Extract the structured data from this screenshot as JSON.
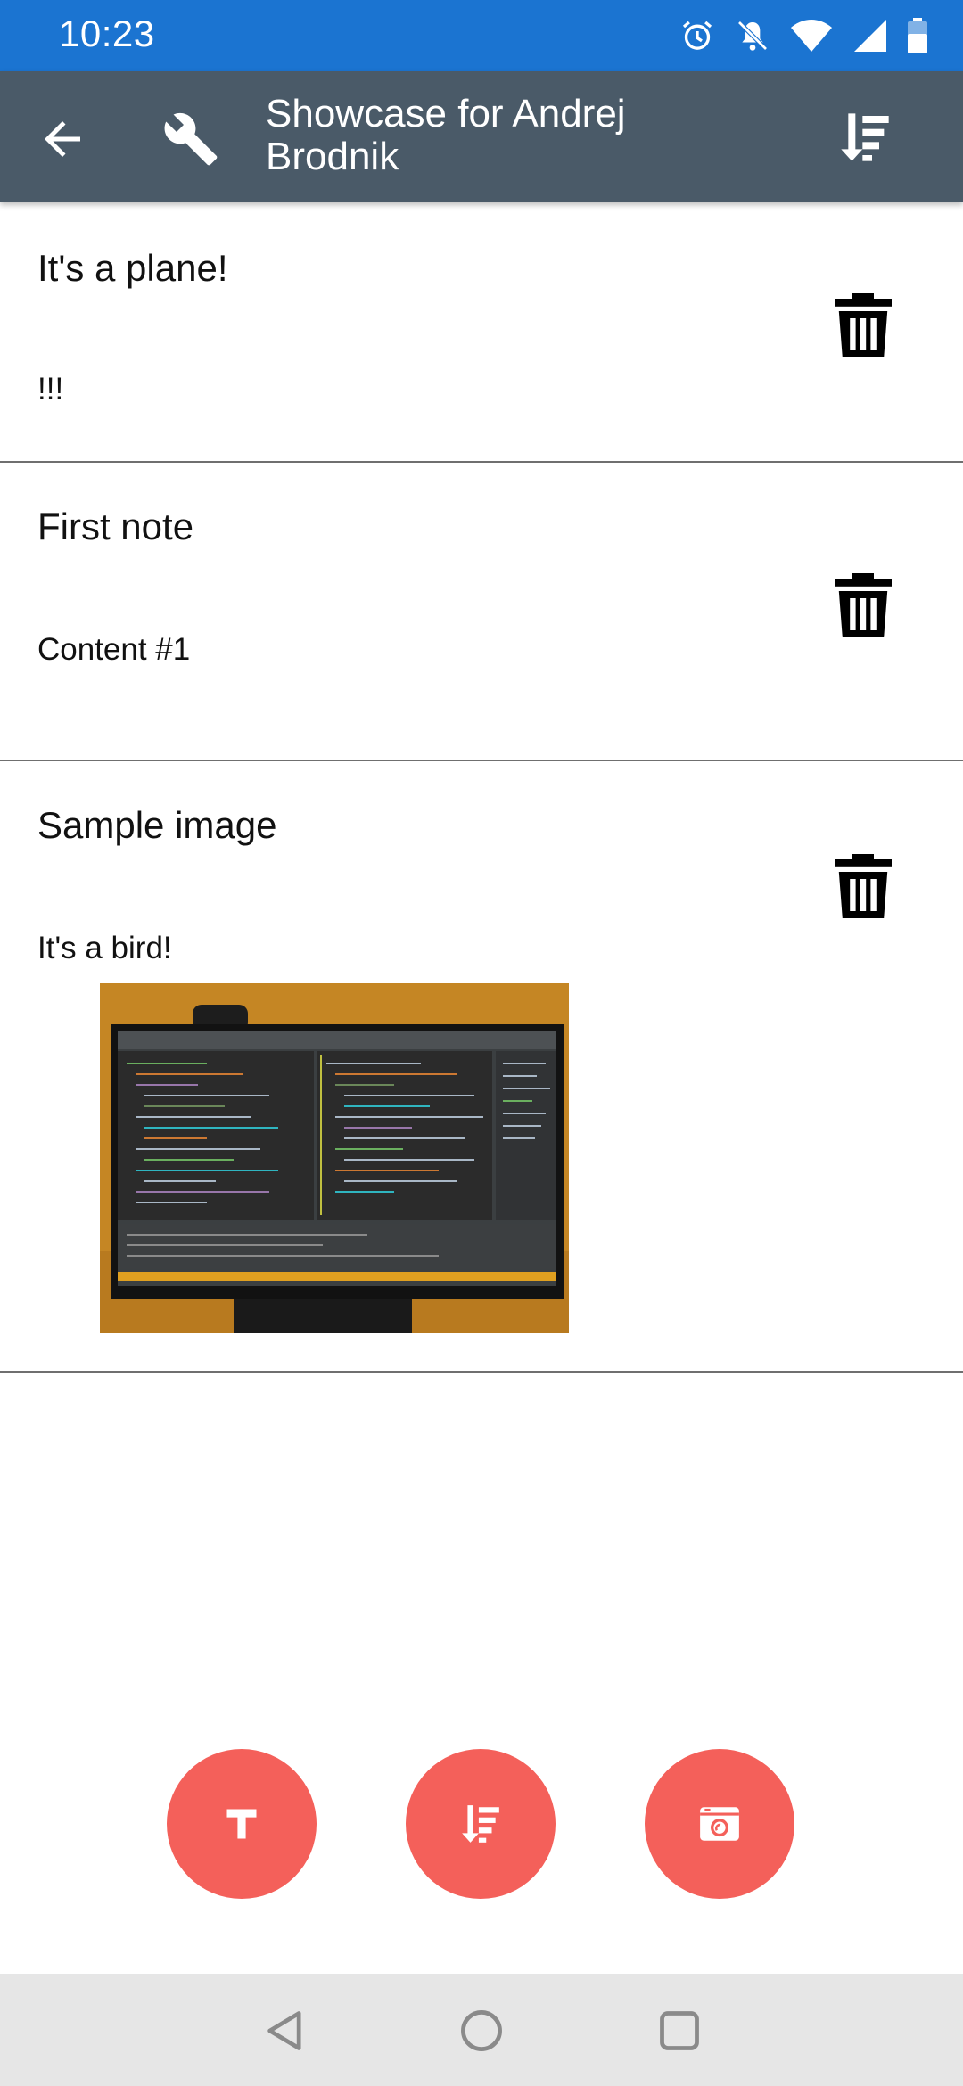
{
  "status_bar": {
    "time": "10:23",
    "icons": [
      "alarm-icon",
      "notifications-off-icon",
      "wifi-icon",
      "signal-icon",
      "battery-icon"
    ]
  },
  "app_bar": {
    "title": "Showcase for Andrej Brodnik",
    "back_icon": "arrow-back-icon",
    "settings_icon": "wrench-icon",
    "sort_icon": "sort-icon"
  },
  "notes": [
    {
      "title": "It's a plane!",
      "content": "!!!"
    },
    {
      "title": "First note",
      "content": "Content #1"
    },
    {
      "title": "Sample image",
      "content": "It's a bird!"
    }
  ],
  "fabs": [
    {
      "icon": "text-note-icon"
    },
    {
      "icon": "sort-icon"
    },
    {
      "icon": "camera-icon"
    }
  ],
  "nav_bar": [
    "back-triangle-icon",
    "home-circle-icon",
    "recents-square-icon"
  ],
  "colors": {
    "status_bar": "#1b74d1",
    "app_bar": "#4a5a68",
    "fab": "#f4605a",
    "nav_bar": "#e6e6e6"
  }
}
